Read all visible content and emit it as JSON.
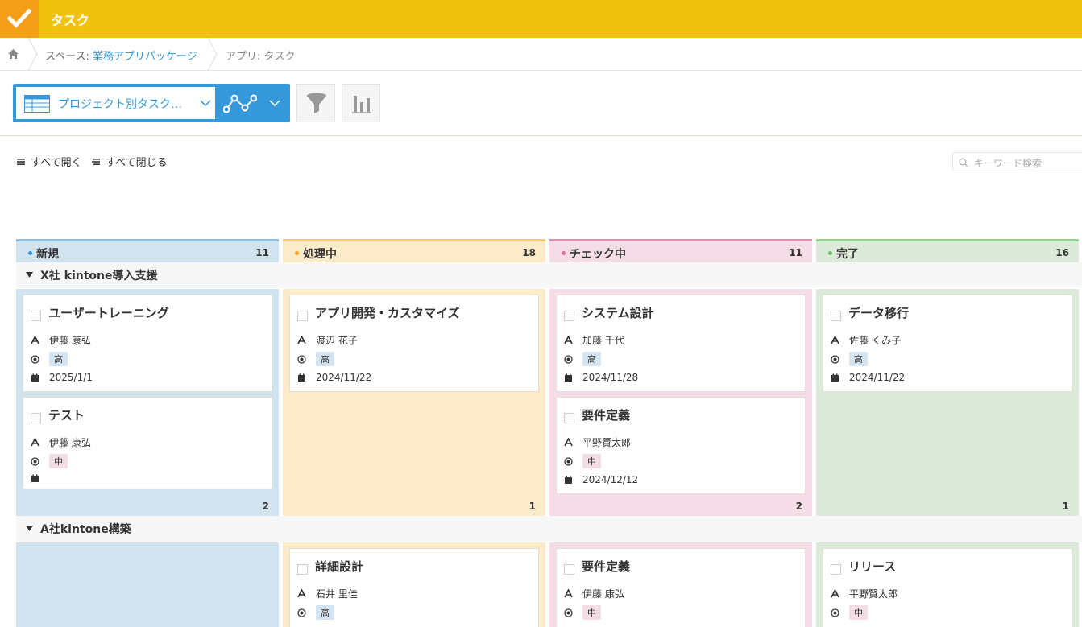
{
  "app": {
    "title": "タスク",
    "accent": "#f0c20e",
    "check_bg": "#f49f17"
  },
  "breadcrumb": {
    "space_prefix": "スペース: ",
    "space_name": "業務アプリパッケージ",
    "app_label": "アプリ: タスク"
  },
  "toolbar": {
    "view_name": "プロジェクト別タスク…",
    "icons": {
      "view": "table-icon",
      "graph": "graph-icon",
      "filter": "funnel-icon",
      "chart": "bar-chart-icon"
    }
  },
  "actions": {
    "expand_all": "すべて開く",
    "collapse_all": "すべて閉じる"
  },
  "search": {
    "placeholder": "キーワード検索"
  },
  "columns": [
    {
      "name": "新規",
      "count": "11",
      "color": "#8cbfe4",
      "bg": "#d2e3f0"
    },
    {
      "name": "処理中",
      "count": "18",
      "color": "#f5cb6c",
      "bg": "#fcebc9"
    },
    {
      "name": "チェック中",
      "count": "11",
      "color": "#e58db0",
      "bg": "#f4dde6"
    },
    {
      "name": "完了",
      "count": "16",
      "color": "#92d38d",
      "bg": "#dcebd9"
    }
  ],
  "groups": [
    {
      "name": "X社 kintone導入支援",
      "lanes": [
        {
          "count": "2",
          "cards": [
            {
              "title": "ユーザートレーニング",
              "assignee": "伊藤 康弘",
              "priority": "高",
              "date": "2025/1/1"
            },
            {
              "title": "テスト",
              "assignee": "伊藤 康弘",
              "priority": "中",
              "date": ""
            }
          ]
        },
        {
          "count": "1",
          "cards": [
            {
              "title": "アプリ開発・カスタマイズ",
              "assignee": "渡辺 花子",
              "priority": "高",
              "date": "2024/11/22"
            }
          ]
        },
        {
          "count": "2",
          "cards": [
            {
              "title": "システム設計",
              "assignee": "加藤 千代",
              "priority": "高",
              "date": "2024/11/28"
            },
            {
              "title": "要件定義",
              "assignee": "平野賢太郎",
              "priority": "中",
              "date": "2024/12/12"
            }
          ]
        },
        {
          "count": "1",
          "cards": [
            {
              "title": "データ移行",
              "assignee": "佐藤 くみ子",
              "priority": "高",
              "date": "2024/11/22"
            }
          ]
        }
      ]
    },
    {
      "name": "A社kintone構築",
      "lanes": [
        {
          "cards": []
        },
        {
          "cards": [
            {
              "title": "詳細設計",
              "assignee": "石井 里佳",
              "priority": "高"
            }
          ]
        },
        {
          "cards": [
            {
              "title": "要件定義",
              "assignee": "伊藤 康弘",
              "priority": "中"
            }
          ]
        },
        {
          "cards": [
            {
              "title": "リリース",
              "assignee": "平野賢太郎",
              "priority": "中"
            }
          ]
        }
      ]
    }
  ]
}
